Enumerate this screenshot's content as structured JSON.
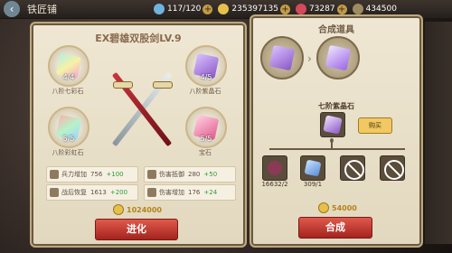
{
  "top_bar": {
    "shop_name": "铁匠铺",
    "stamina": "117/120",
    "gold": "235397135",
    "gems": "73287",
    "other": "434500"
  },
  "left_panel": {
    "title": "EX碧雄双股剑LV.9",
    "slots": [
      {
        "count": "4/4",
        "label": "八阶七彩石"
      },
      {
        "count": "4/5",
        "label": "八阶紫晶石"
      },
      {
        "count": "5/5",
        "label": "八阶彩虹石"
      },
      {
        "count": "5/5",
        "label": "宝石"
      }
    ],
    "stats": [
      {
        "label": "兵力增加",
        "value": "756",
        "inc": "+100"
      },
      {
        "label": "伤害抵御",
        "value": "280",
        "inc": "+50"
      },
      {
        "label": "战后恢复",
        "value": "1613",
        "inc": "+200"
      },
      {
        "label": "伤害增加",
        "value": "176",
        "inc": "+24"
      }
    ],
    "cost": "1024000",
    "evolve_label": "进化"
  },
  "right_panel": {
    "title": "合成道具",
    "item_name": "七阶紫晶石",
    "item_count": "0",
    "buy_label": "购买",
    "materials": [
      {
        "count": "16632/2"
      },
      {
        "count": "309/1"
      }
    ],
    "cost": "54000",
    "compose_label": "合成"
  },
  "colors": {
    "accent_red": "#c02f28",
    "gem_purple": "#8b57c7",
    "gem_rainbow": "#77d2c5",
    "gem_pink": "#e15c8c",
    "coin_gold": "#e7bf4b"
  }
}
